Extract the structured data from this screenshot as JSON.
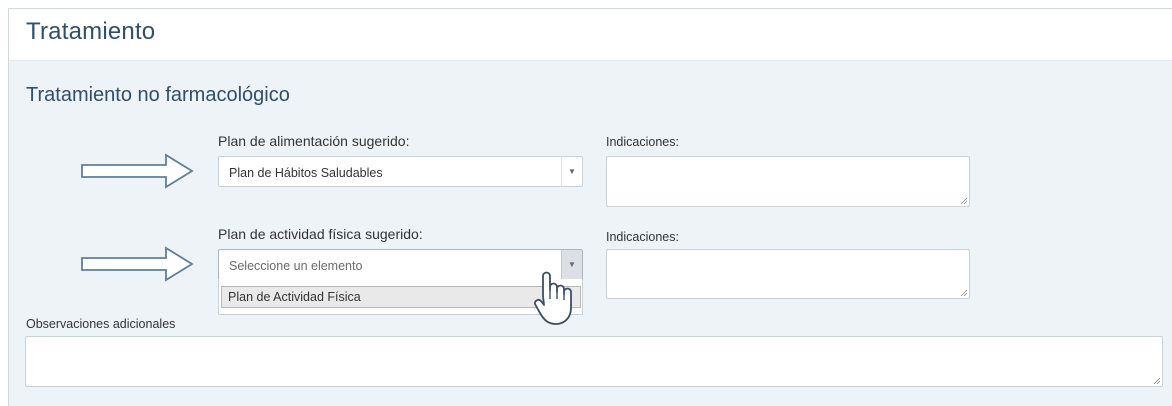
{
  "header": {
    "title": "Tratamiento"
  },
  "section": {
    "title": "Tratamiento no farmacológico"
  },
  "diet_plan": {
    "label": "Plan de alimentación sugerido:",
    "selected": "Plan de Hábitos Saludables",
    "indications_label": "Indicaciones:"
  },
  "activity_plan": {
    "label": "Plan de actividad física sugerido:",
    "placeholder": "Seleccione un elemento",
    "options": [
      "Plan de Actividad Física"
    ],
    "indications_label": "Indicaciones:"
  },
  "observations": {
    "label": "Observaciones adicionales"
  },
  "icons": {
    "pointer_arrow": "right-arrow-outline-icon",
    "caret": "caret-down-icon",
    "cursor": "hand-pointer-cursor-icon",
    "resize": "resize-grip-icon"
  },
  "colors": {
    "panel_bg": "#eef3f8",
    "title": "#2f4f6b",
    "arrow_stroke": "#5f7f99"
  }
}
